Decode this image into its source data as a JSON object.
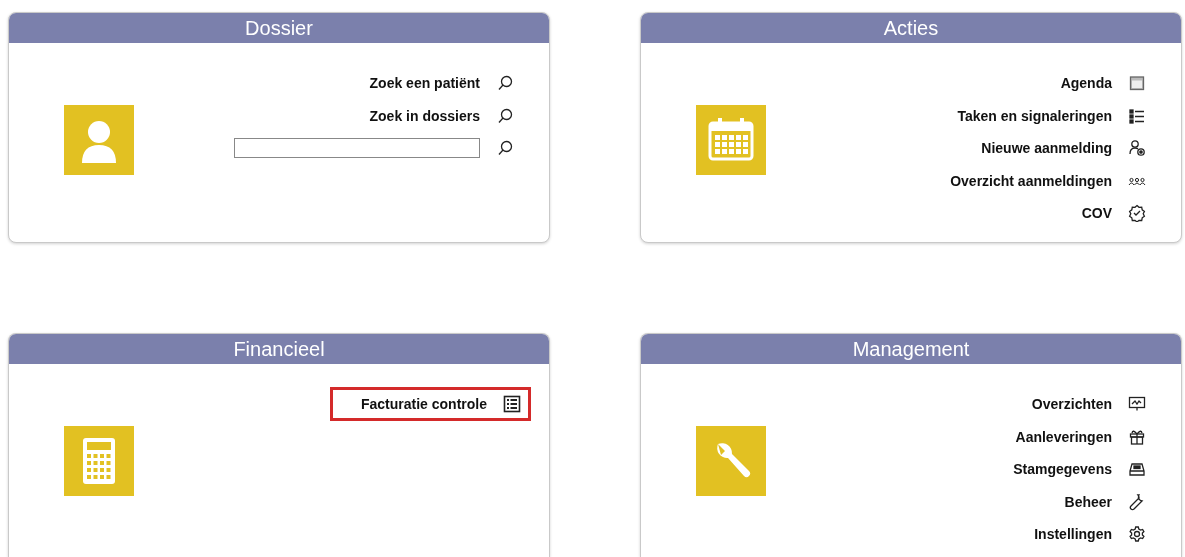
{
  "panels": [
    {
      "title": "Dossier",
      "items": [
        {
          "kind": "link",
          "label": "Zoek een patiënt",
          "highlighted": false
        },
        {
          "kind": "link",
          "label": "Zoek in dossiers",
          "highlighted": false
        },
        {
          "kind": "field",
          "highlighted": false
        }
      ]
    },
    {
      "title": "Acties",
      "items": [
        {
          "kind": "link",
          "label": "Agenda",
          "highlighted": false
        },
        {
          "kind": "link",
          "label": "Taken en signaleringen",
          "highlighted": false
        },
        {
          "kind": "link",
          "label": "Nieuwe aanmelding",
          "highlighted": false
        },
        {
          "kind": "link",
          "label": "Overzicht aanmeldingen",
          "highlighted": false
        },
        {
          "kind": "link",
          "label": "COV",
          "highlighted": false
        }
      ]
    },
    {
      "title": "Financieel",
      "items": [
        {
          "kind": "link",
          "label": "Facturatie controle",
          "highlighted": true
        }
      ]
    },
    {
      "title": "Management",
      "items": [
        {
          "kind": "link",
          "label": "Overzichten",
          "highlighted": false
        },
        {
          "kind": "link",
          "label": "Aanleveringen",
          "highlighted": false
        },
        {
          "kind": "link",
          "label": "Stamgegevens",
          "highlighted": false
        },
        {
          "kind": "link",
          "label": "Beheer",
          "highlighted": false
        },
        {
          "kind": "link",
          "label": "Instellingen",
          "highlighted": false
        }
      ]
    }
  ]
}
